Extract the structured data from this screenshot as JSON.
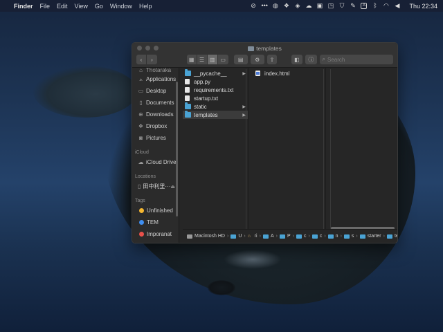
{
  "menubar": {
    "app_name": "Finder",
    "menus": [
      "File",
      "Edit",
      "View",
      "Go",
      "Window",
      "Help"
    ],
    "clock": "Thu 22:34"
  },
  "window": {
    "title": "templates",
    "search_placeholder": "Search"
  },
  "sidebar": {
    "cut_item": "Thotaraka",
    "favorites": [
      {
        "label": "Applications",
        "icon": "applications-icon"
      },
      {
        "label": "Desktop",
        "icon": "desktop-icon"
      },
      {
        "label": "Documents",
        "icon": "documents-icon"
      },
      {
        "label": "Downloads",
        "icon": "downloads-icon"
      },
      {
        "label": "Dropbox",
        "icon": "dropbox-icon"
      },
      {
        "label": "Pictures",
        "icon": "pictures-icon"
      }
    ],
    "icloud_header": "iCloud",
    "icloud_drive": "iCloud Drive",
    "locations_header": "Locations",
    "location_item": "田中利里···",
    "tags_header": "Tags",
    "tags": [
      {
        "label": "Unfinished",
        "color": "#f5b731"
      },
      {
        "label": "TEM",
        "color": "#3f8ef0"
      },
      {
        "label": "Imporanat",
        "color": "#e8504a"
      }
    ]
  },
  "columns": {
    "col1": [
      {
        "name": "__pycache__",
        "type": "folder",
        "has_children": true
      },
      {
        "name": "app.py",
        "type": "file",
        "has_children": false
      },
      {
        "name": "requirements.txt",
        "type": "file",
        "has_children": false
      },
      {
        "name": "startup.txt",
        "type": "file",
        "has_children": false
      },
      {
        "name": "static",
        "type": "folder",
        "has_children": true
      },
      {
        "name": "templates",
        "type": "folder",
        "has_children": true,
        "selected": true
      }
    ],
    "col2": [
      {
        "name": "index.html",
        "type": "html"
      }
    ]
  },
  "pathbar": {
    "crumbs": [
      "Macintosh HD",
      "U",
      "ri",
      "A",
      "P",
      "c",
      "c",
      "n",
      "s",
      "starter",
      "templates"
    ]
  }
}
